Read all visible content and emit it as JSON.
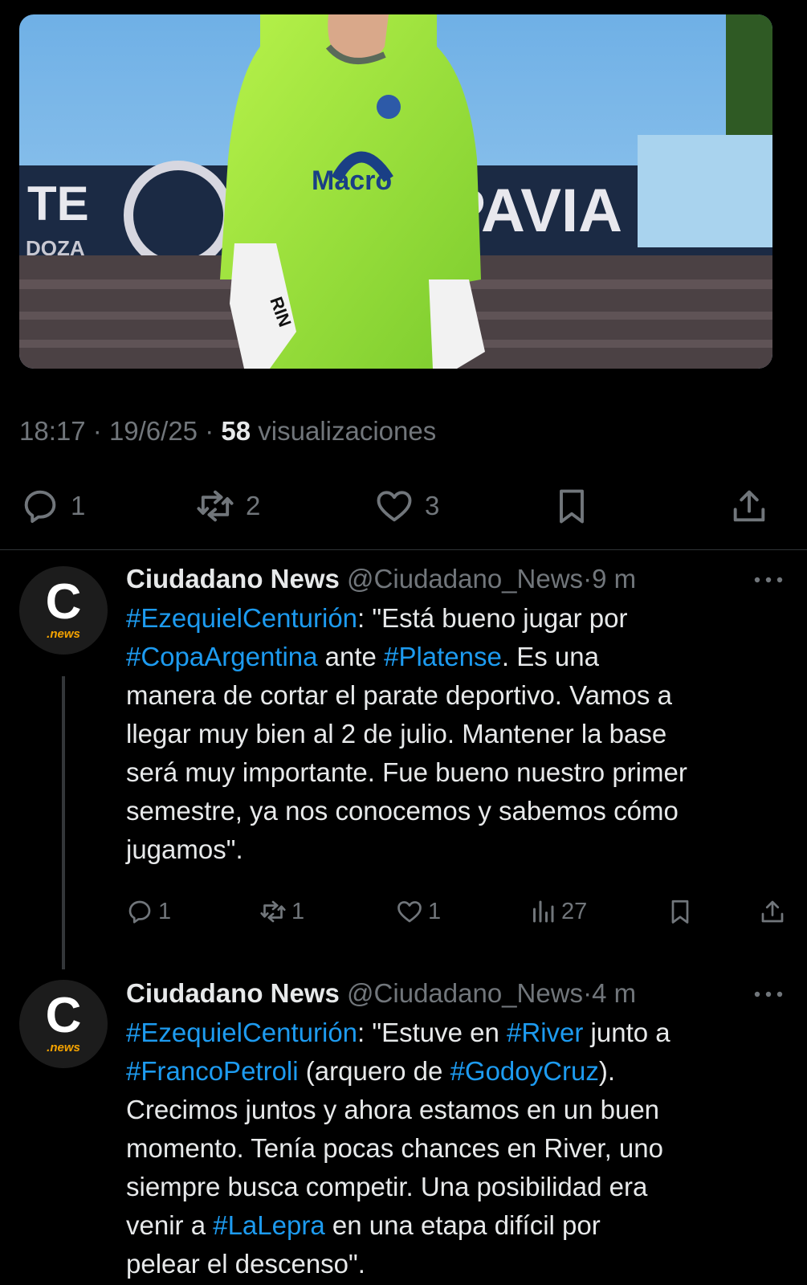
{
  "tweet": {
    "time": "18:17",
    "date": "19/6/25",
    "views_count": "58",
    "views_label": "visualizaciones",
    "photo": {
      "sponsor_text": "Macro",
      "banner_left": "TE",
      "banner_left_sub": "DOZA",
      "banner_right": "PAVIA",
      "glove_text": "RIN"
    },
    "actions": {
      "replies": "1",
      "retweets": "2",
      "likes": "3"
    }
  },
  "replies": [
    {
      "avatar_letter": "C",
      "avatar_sub": ".news",
      "name": "Ciudadano News",
      "handle": "@Ciudadano_News",
      "dot": "·",
      "time": "9 m",
      "lines": [
        [
          {
            "t": "#EzequielCenturión",
            "tag": true
          },
          {
            "t": ": \"Está bueno jugar por"
          }
        ],
        [
          {
            "t": "#CopaArgentina",
            "tag": true
          },
          {
            "t": " ante "
          },
          {
            "t": "#Platense",
            "tag": true
          },
          {
            "t": ". Es una"
          }
        ],
        [
          {
            "t": "manera de cortar el parate deportivo. Vamos a"
          }
        ],
        [
          {
            "t": "llegar muy bien al 2 de julio. Mantener la base"
          }
        ],
        [
          {
            "t": "será muy importante. Fue bueno nuestro primer"
          }
        ],
        [
          {
            "t": "semestre, ya nos conocemos y sabemos cómo"
          }
        ],
        [
          {
            "t": "jugamos\"."
          }
        ]
      ],
      "actions": {
        "replies": "1",
        "retweets": "1",
        "likes": "1",
        "views": "27"
      }
    },
    {
      "avatar_letter": "C",
      "avatar_sub": ".news",
      "name": "Ciudadano News",
      "handle": "@Ciudadano_News",
      "dot": "·",
      "time": "4 m",
      "lines": [
        [
          {
            "t": "#EzequielCenturión",
            "tag": true
          },
          {
            "t": ": \"Estuve en "
          },
          {
            "t": "#River",
            "tag": true
          },
          {
            "t": " junto a"
          }
        ],
        [
          {
            "t": "#FrancoPetroli",
            "tag": true
          },
          {
            "t": " (arquero de "
          },
          {
            "t": "#GodoyCruz",
            "tag": true
          },
          {
            "t": ")."
          }
        ],
        [
          {
            "t": "Crecimos juntos y ahora estamos en un buen"
          }
        ],
        [
          {
            "t": "momento. Tenía pocas chances en River, uno"
          }
        ],
        [
          {
            "t": "siempre busca competir. Una posibilidad era"
          }
        ],
        [
          {
            "t": "venir a "
          },
          {
            "t": "#LaLepra",
            "tag": true
          },
          {
            "t": " en una etapa difícil por"
          }
        ],
        [
          {
            "t": "pelear el descenso\"."
          }
        ]
      ]
    }
  ]
}
